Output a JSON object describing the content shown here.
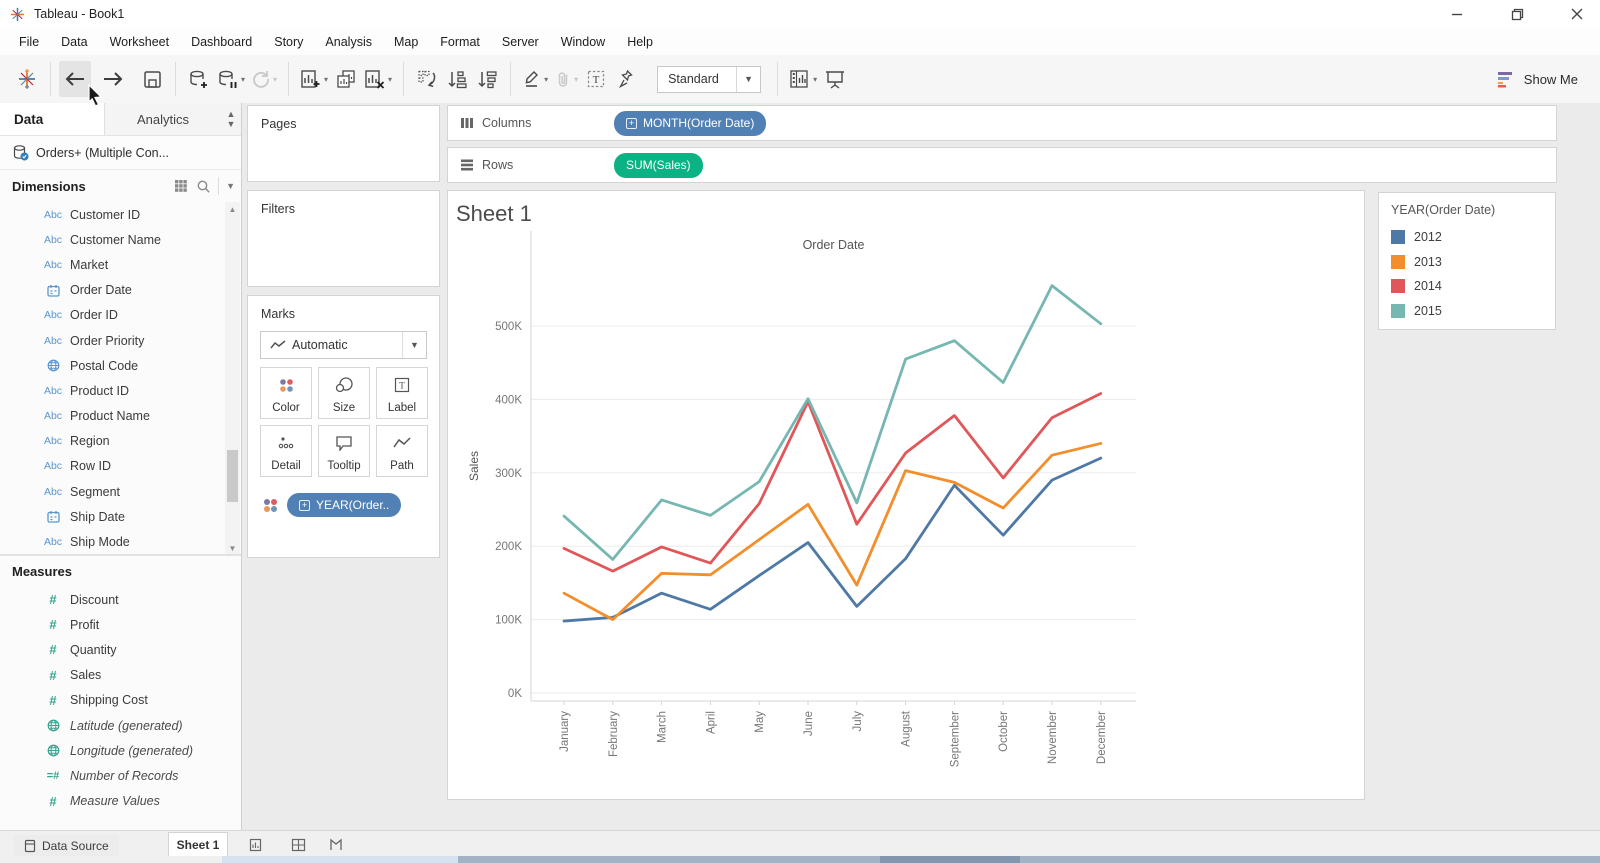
{
  "window": {
    "title": "Tableau - Book1"
  },
  "menu": {
    "items": [
      "File",
      "Data",
      "Worksheet",
      "Dashboard",
      "Story",
      "Analysis",
      "Map",
      "Format",
      "Server",
      "Window",
      "Help"
    ]
  },
  "toolbar": {
    "view_mode": "Standard",
    "show_me_label": "Show Me",
    "buttons": [
      "tableau-logo",
      "back",
      "forward",
      "save",
      "add-data-source",
      "pause-auto-updates",
      "refresh",
      "new-worksheet",
      "duplicate-sheet",
      "clear-sheet",
      "swap-rows-columns",
      "sort-ascending",
      "sort-descending",
      "highlight",
      "group-members",
      "show-mark-labels",
      "fix-axes",
      "view-mode-select",
      "show-hide-cards",
      "presentation-mode",
      "show-me"
    ]
  },
  "sidebar": {
    "tabs": {
      "data": "Data",
      "analytics": "Analytics"
    },
    "datasource": "Orders+ (Multiple Con...",
    "dimensions": {
      "header": "Dimensions",
      "items": [
        {
          "icon": "abc",
          "label": "Customer ID"
        },
        {
          "icon": "abc",
          "label": "Customer Name"
        },
        {
          "icon": "abc",
          "label": "Market"
        },
        {
          "icon": "cal",
          "label": "Order Date"
        },
        {
          "icon": "abc",
          "label": "Order ID"
        },
        {
          "icon": "abc",
          "label": "Order Priority"
        },
        {
          "icon": "globe",
          "label": "Postal Code"
        },
        {
          "icon": "abc",
          "label": "Product ID"
        },
        {
          "icon": "abc",
          "label": "Product Name"
        },
        {
          "icon": "abc",
          "label": "Region"
        },
        {
          "icon": "abc",
          "label": "Row ID"
        },
        {
          "icon": "abc",
          "label": "Segment"
        },
        {
          "icon": "cal",
          "label": "Ship Date"
        },
        {
          "icon": "abc",
          "label": "Ship Mode"
        }
      ]
    },
    "measures": {
      "header": "Measures",
      "items": [
        {
          "icon": "hash",
          "label": "Discount"
        },
        {
          "icon": "hash",
          "label": "Profit"
        },
        {
          "icon": "hash",
          "label": "Quantity"
        },
        {
          "icon": "hash",
          "label": "Sales"
        },
        {
          "icon": "hash",
          "label": "Shipping Cost"
        },
        {
          "icon": "globe",
          "label": "Latitude (generated)",
          "italic": true
        },
        {
          "icon": "globe",
          "label": "Longitude (generated)",
          "italic": true
        },
        {
          "icon": "eqhash",
          "label": "Number of Records",
          "italic": true
        },
        {
          "icon": "hash",
          "label": "Measure Values",
          "italic": true
        }
      ]
    }
  },
  "cards": {
    "pages_label": "Pages",
    "filters_label": "Filters",
    "marks": {
      "label": "Marks",
      "mark_type": "Automatic",
      "buttons": [
        "Color",
        "Size",
        "Label",
        "Detail",
        "Tooltip",
        "Path"
      ],
      "pill": "YEAR(Order.."
    }
  },
  "shelves": {
    "columns": {
      "label": "Columns",
      "pill": "MONTH(Order Date)"
    },
    "rows": {
      "label": "Rows",
      "pill": "SUM(Sales)"
    }
  },
  "sheet": {
    "title": "Sheet 1"
  },
  "legend": {
    "title": "YEAR(Order Date)",
    "items": [
      {
        "label": "2012",
        "color": "#4e79a7"
      },
      {
        "label": "2013",
        "color": "#f28e2b"
      },
      {
        "label": "2014",
        "color": "#e15759"
      },
      {
        "label": "2015",
        "color": "#76b7b2"
      }
    ]
  },
  "tabs_bar": {
    "data_source": "Data Source",
    "sheet": "Sheet 1"
  },
  "chart_data": {
    "type": "line",
    "title": "Order Date",
    "xlabel": "Order Date",
    "ylabel": "Sales",
    "values_unit": "thousands (K) of Sales",
    "categories": [
      "January",
      "February",
      "March",
      "April",
      "May",
      "June",
      "July",
      "August",
      "September",
      "October",
      "November",
      "December"
    ],
    "y_ticks": [
      "0K",
      "100K",
      "200K",
      "300K",
      "400K",
      "500K"
    ],
    "y_tick_values": [
      0,
      100,
      200,
      300,
      400,
      500
    ],
    "ylim": [
      0,
      570
    ],
    "grid": true,
    "legend_position": "right",
    "series": [
      {
        "name": "2012",
        "color": "#4e79a7",
        "values": [
          98,
          103,
          136,
          114,
          160,
          205,
          118,
          183,
          283,
          215,
          290,
          320
        ]
      },
      {
        "name": "2013",
        "color": "#f28e2b",
        "values": [
          136,
          100,
          163,
          161,
          209,
          257,
          147,
          303,
          287,
          252,
          324,
          340
        ]
      },
      {
        "name": "2014",
        "color": "#e15759",
        "values": [
          197,
          166,
          199,
          177,
          258,
          397,
          230,
          327,
          378,
          293,
          375,
          408
        ]
      },
      {
        "name": "2015",
        "color": "#76b7b2",
        "values": [
          241,
          182,
          263,
          242,
          288,
          401,
          259,
          455,
          480,
          423,
          555,
          503
        ]
      }
    ]
  }
}
